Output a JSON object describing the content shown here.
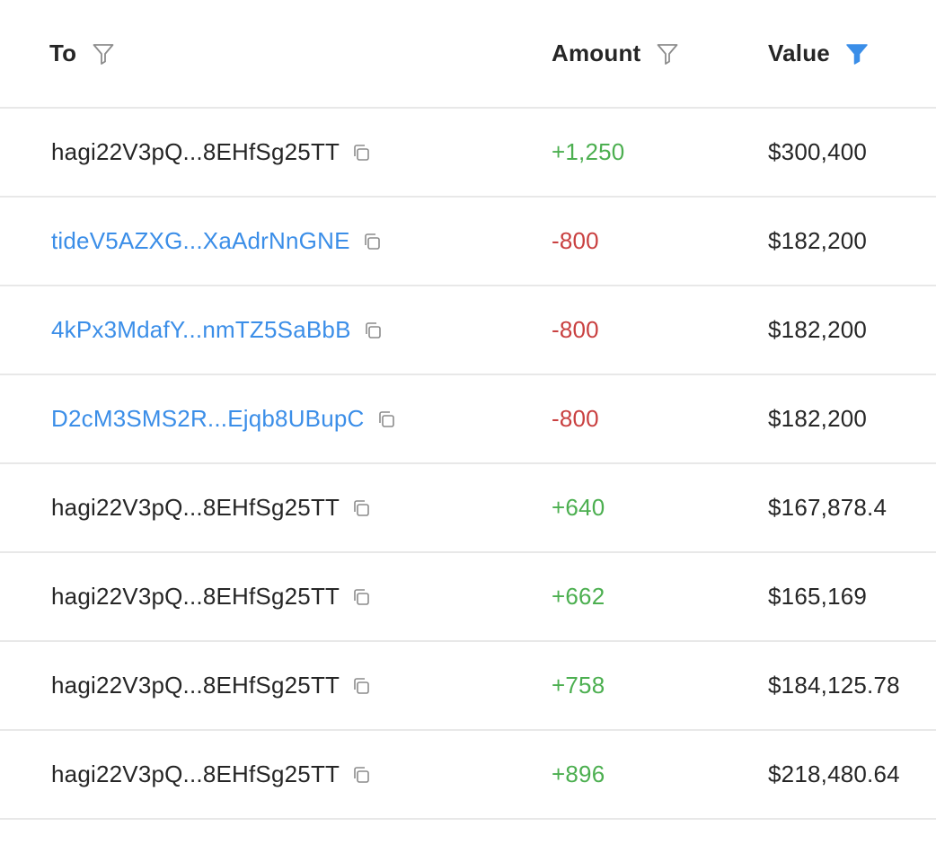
{
  "table": {
    "columns": [
      {
        "label": "To",
        "filter_active": false
      },
      {
        "label": "Amount",
        "filter_active": false
      },
      {
        "label": "Value",
        "filter_active": true
      }
    ],
    "colors": {
      "positive": "#4caf50",
      "negative": "#c94040",
      "link": "#3b8ee8",
      "filter_active": "#3b8ee8",
      "filter_inactive": "#8c8c8c"
    },
    "rows": [
      {
        "to": "hagi22V3pQ...8EHfSg25TT",
        "to_is_link": false,
        "amount": "+1,250",
        "amount_sign": "positive",
        "value": "$300,400"
      },
      {
        "to": "tideV5AZXG...XaAdrNnGNE",
        "to_is_link": true,
        "amount": "-800",
        "amount_sign": "negative",
        "value": "$182,200"
      },
      {
        "to": "4kPx3MdafY...nmTZ5SaBbB",
        "to_is_link": true,
        "amount": "-800",
        "amount_sign": "negative",
        "value": "$182,200"
      },
      {
        "to": "D2cM3SMS2R...Ejqb8UBupC",
        "to_is_link": true,
        "amount": "-800",
        "amount_sign": "negative",
        "value": "$182,200"
      },
      {
        "to": "hagi22V3pQ...8EHfSg25TT",
        "to_is_link": false,
        "amount": "+640",
        "amount_sign": "positive",
        "value": "$167,878.4"
      },
      {
        "to": "hagi22V3pQ...8EHfSg25TT",
        "to_is_link": false,
        "amount": "+662",
        "amount_sign": "positive",
        "value": "$165,169"
      },
      {
        "to": "hagi22V3pQ...8EHfSg25TT",
        "to_is_link": false,
        "amount": "+758",
        "amount_sign": "positive",
        "value": "$184,125.78"
      },
      {
        "to": "hagi22V3pQ...8EHfSg25TT",
        "to_is_link": false,
        "amount": "+896",
        "amount_sign": "positive",
        "value": "$218,480.64"
      }
    ]
  },
  "icons": {
    "filter": "filter-icon",
    "copy": "copy-icon"
  }
}
